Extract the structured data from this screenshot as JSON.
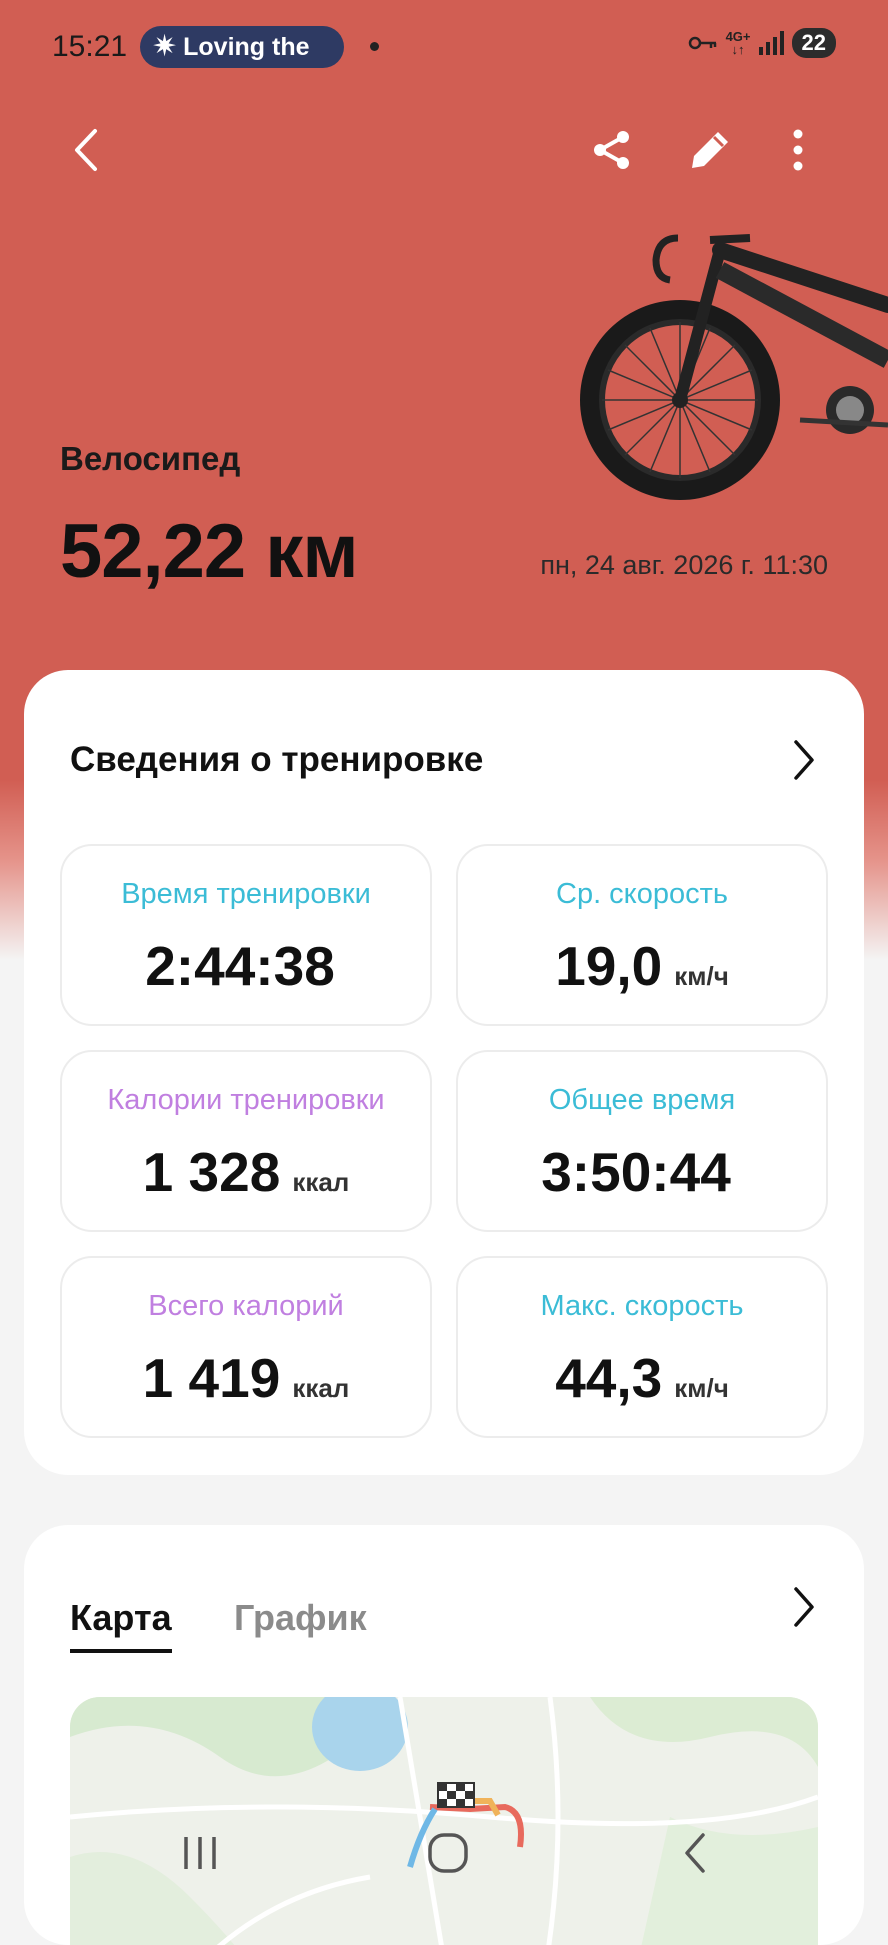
{
  "status_bar": {
    "time": "15:21",
    "notification_text": "Loving the",
    "network": "4G+",
    "battery": "22"
  },
  "header": {
    "activity_type": "Велосипед",
    "distance": "52,22 км",
    "datetime": "пн, 24 авг. 2026 г. 11:30"
  },
  "workout_details": {
    "title": "Сведения о тренировке",
    "stats": [
      {
        "label": "Время тренировки",
        "value": "2:44:38",
        "unit": "",
        "label_color": "#3bbcd6"
      },
      {
        "label": "Ср. скорость",
        "value": "19,0",
        "unit": "км/ч",
        "label_color": "#3bbcd6"
      },
      {
        "label": "Калории тренировки",
        "value": "1 328",
        "unit": "ккал",
        "label_color": "#c07fe0"
      },
      {
        "label": "Общее время",
        "value": "3:50:44",
        "unit": "",
        "label_color": "#3bbcd6"
      },
      {
        "label": "Всего калорий",
        "value": "1 419",
        "unit": "ккал",
        "label_color": "#c07fe0"
      },
      {
        "label": "Макс. скорость",
        "value": "44,3",
        "unit": "км/ч",
        "label_color": "#3bbcd6"
      }
    ]
  },
  "map_section": {
    "tabs": [
      "Карта",
      "График"
    ],
    "active_tab": "Карта"
  },
  "icons": {
    "back": "back-arrow-icon",
    "share": "share-icon",
    "edit": "pencil-icon",
    "more": "more-vertical-icon"
  },
  "colors": {
    "hero_background": "#d15e53",
    "accent_teal": "#3bbcd6",
    "accent_purple": "#c07fe0"
  }
}
